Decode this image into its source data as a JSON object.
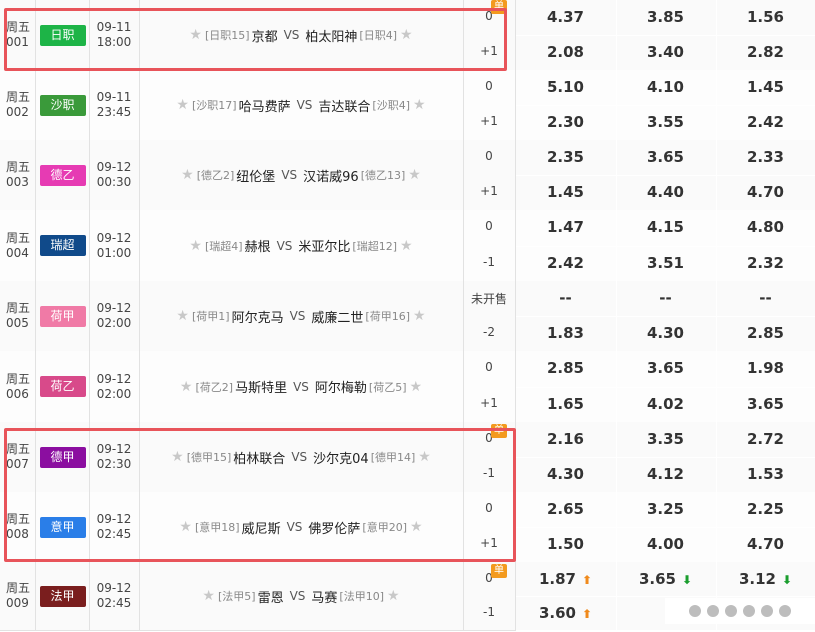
{
  "single_label": "单",
  "vs_label": "VS",
  "colors": {
    "odds_bg": "#eef7dc",
    "highlight": "#e8545a",
    "single_badge": "#f39a1e",
    "up": "#f08a1c",
    "down": "#1a9e2e"
  },
  "matches": [
    {
      "week": "周五",
      "num": "001",
      "league": "日职",
      "league_color": "#1db447",
      "date": "09-11",
      "time": "18:00",
      "home_rank": "[日职15]",
      "home": "京都",
      "away": "柏太阳神",
      "away_rank": "[日职4]",
      "single": true,
      "handicaps": [
        "0",
        "+1"
      ],
      "odds": [
        [
          "4.37",
          "3.85",
          "1.56"
        ],
        [
          "2.08",
          "3.40",
          "2.82"
        ]
      ],
      "arrows": [
        [
          "",
          "",
          ""
        ],
        [
          "",
          "",
          ""
        ]
      ]
    },
    {
      "week": "周五",
      "num": "002",
      "league": "沙职",
      "league_color": "#3a9a3a",
      "date": "09-11",
      "time": "23:45",
      "home_rank": "[沙职17]",
      "home": "哈马费萨",
      "away": "吉达联合",
      "away_rank": "[沙职4]",
      "single": false,
      "handicaps": [
        "0",
        "+1"
      ],
      "odds": [
        [
          "5.10",
          "4.10",
          "1.45"
        ],
        [
          "2.30",
          "3.55",
          "2.42"
        ]
      ],
      "arrows": [
        [
          "",
          "",
          ""
        ],
        [
          "",
          "",
          ""
        ]
      ]
    },
    {
      "week": "周五",
      "num": "003",
      "league": "德乙",
      "league_color": "#e63bb3",
      "date": "09-12",
      "time": "00:30",
      "home_rank": "[德乙2]",
      "home": "纽伦堡",
      "away": "汉诺威96",
      "away_rank": "[德乙13]",
      "single": false,
      "handicaps": [
        "0",
        "+1"
      ],
      "odds": [
        [
          "2.35",
          "3.65",
          "2.33"
        ],
        [
          "1.45",
          "4.40",
          "4.70"
        ]
      ],
      "arrows": [
        [
          "",
          "",
          ""
        ],
        [
          "",
          "",
          ""
        ]
      ]
    },
    {
      "week": "周五",
      "num": "004",
      "league": "瑞超",
      "league_color": "#104a8a",
      "date": "09-12",
      "time": "01:00",
      "home_rank": "[瑞超4]",
      "home": "赫根",
      "away": "米亚尔比",
      "away_rank": "[瑞超12]",
      "single": false,
      "handicaps": [
        "0",
        "-1"
      ],
      "odds": [
        [
          "1.47",
          "4.15",
          "4.80"
        ],
        [
          "2.42",
          "3.51",
          "2.32"
        ]
      ],
      "arrows": [
        [
          "",
          "",
          ""
        ],
        [
          "",
          "",
          ""
        ]
      ]
    },
    {
      "week": "周五",
      "num": "005",
      "league": "荷甲",
      "league_color": "#f07aa6",
      "date": "09-12",
      "time": "02:00",
      "home_rank": "[荷甲1]",
      "home": "阿尔克马",
      "away": "威廉二世",
      "away_rank": "[荷甲16]",
      "single": false,
      "handicaps": [
        "未开售",
        "-2"
      ],
      "odds": [
        [
          "--",
          "--",
          "--"
        ],
        [
          "1.83",
          "4.30",
          "2.85"
        ]
      ],
      "arrows": [
        [
          "",
          "",
          ""
        ],
        [
          "",
          "",
          ""
        ]
      ]
    },
    {
      "week": "周五",
      "num": "006",
      "league": "荷乙",
      "league_color": "#d84a8a",
      "date": "09-12",
      "time": "02:00",
      "home_rank": "[荷乙2]",
      "home": "马斯特里",
      "away": "阿尔梅勒",
      "away_rank": "[荷乙5]",
      "single": false,
      "handicaps": [
        "0",
        "+1"
      ],
      "odds": [
        [
          "2.85",
          "3.65",
          "1.98"
        ],
        [
          "1.65",
          "4.02",
          "3.65"
        ]
      ],
      "arrows": [
        [
          "",
          "",
          ""
        ],
        [
          "",
          "",
          ""
        ]
      ]
    },
    {
      "week": "周五",
      "num": "007",
      "league": "德甲",
      "league_color": "#8b0ea0",
      "date": "09-12",
      "time": "02:30",
      "home_rank": "[德甲15]",
      "home": "柏林联合",
      "away": "沙尔克04",
      "away_rank": "[德甲14]",
      "single": true,
      "handicaps": [
        "0",
        "-1"
      ],
      "odds": [
        [
          "2.16",
          "3.35",
          "2.72"
        ],
        [
          "4.30",
          "4.12",
          "1.53"
        ]
      ],
      "arrows": [
        [
          "",
          "",
          ""
        ],
        [
          "",
          "",
          ""
        ]
      ]
    },
    {
      "week": "周五",
      "num": "008",
      "league": "意甲",
      "league_color": "#2a7ee8",
      "date": "09-12",
      "time": "02:45",
      "home_rank": "[意甲18]",
      "home": "威尼斯",
      "away": "佛罗伦萨",
      "away_rank": "[意甲20]",
      "single": false,
      "handicaps": [
        "0",
        "+1"
      ],
      "odds": [
        [
          "2.65",
          "3.25",
          "2.25"
        ],
        [
          "1.50",
          "4.00",
          "4.70"
        ]
      ],
      "arrows": [
        [
          "",
          "",
          ""
        ],
        [
          "",
          "",
          ""
        ]
      ]
    },
    {
      "week": "周五",
      "num": "009",
      "league": "法甲",
      "league_color": "#7a1e1e",
      "date": "09-12",
      "time": "02:45",
      "home_rank": "[法甲5]",
      "home": "雷恩",
      "away": "马赛",
      "away_rank": "[法甲10]",
      "single": true,
      "handicaps": [
        "0",
        "-1"
      ],
      "odds": [
        [
          "1.87",
          "3.65",
          "3.12"
        ],
        [
          "3.60",
          "",
          ""
        ]
      ],
      "arrows": [
        [
          "up",
          "down",
          "down"
        ],
        [
          "up",
          "",
          ""
        ]
      ]
    }
  ]
}
